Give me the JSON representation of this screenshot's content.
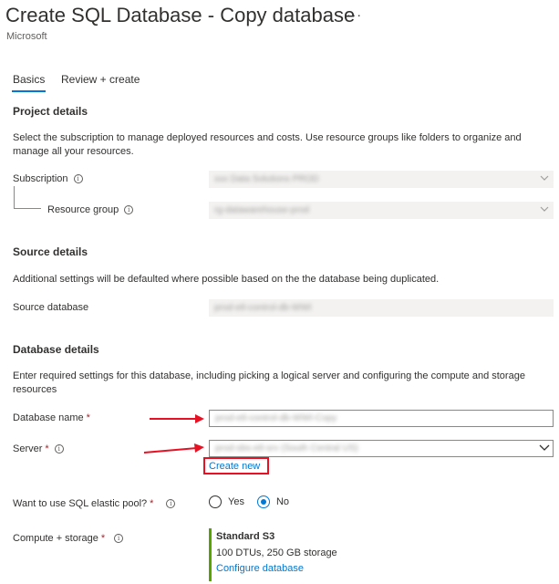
{
  "header": {
    "title": "Create SQL Database - Copy database",
    "more_label": "···",
    "subtitle": "Microsoft"
  },
  "tabs": [
    {
      "label": "Basics",
      "selected": true
    },
    {
      "label": "Review + create",
      "selected": false
    }
  ],
  "project_details": {
    "title": "Project details",
    "description": "Select the subscription to manage deployed resources and costs. Use resource groups like folders to organize and manage all your resources.",
    "subscription": {
      "label": "Subscription",
      "value": "xxx Data Solutions PROD"
    },
    "resource_group": {
      "label": "Resource group",
      "value": "rg-datawarehouse-prod"
    }
  },
  "source_details": {
    "title": "Source details",
    "description": "Additional settings will be defaulted where possible based on the the database being duplicated.",
    "source_database": {
      "label": "Source database",
      "value": "prod-etl-control-db-WWI"
    }
  },
  "database_details": {
    "title": "Database details",
    "description": "Enter required settings for this database, including picking a logical server and configuring the compute and storage resources",
    "database_name": {
      "label": "Database name",
      "value": "prod-etl-control-db-WWI-Copy"
    },
    "server": {
      "label": "Server",
      "value": "prod-sbs-etl-srv (South Central US)"
    },
    "create_new_label": "Create new",
    "required_mark": "*",
    "elastic_pool": {
      "label": "Want to use SQL elastic pool?",
      "options": [
        {
          "label": "Yes",
          "checked": false
        },
        {
          "label": "No",
          "checked": true
        }
      ]
    },
    "compute_storage": {
      "label": "Compute + storage",
      "tier": "Standard S3",
      "detail": "100 DTUs, 250 GB storage",
      "configure_label": "Configure database"
    }
  },
  "info_glyph": "i",
  "colors": {
    "accent": "#0078d4",
    "highlight_red": "#e81123",
    "required_red": "#a4262c",
    "compute_bar_green": "#57a300"
  }
}
